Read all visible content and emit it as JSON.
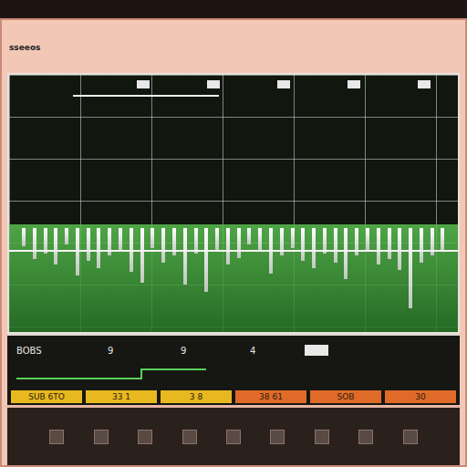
{
  "header": {
    "title": "sseeos"
  },
  "trace": {
    "values": [
      20,
      34,
      28,
      40,
      18,
      52,
      36,
      44,
      30,
      26,
      48,
      60,
      22,
      38,
      30,
      62,
      28,
      70,
      24,
      40,
      33,
      18,
      26,
      50,
      30,
      22,
      36,
      44,
      28,
      38,
      56,
      30,
      24,
      40,
      34,
      46,
      88,
      38,
      30,
      26
    ]
  },
  "readouts": [
    {
      "label": "BOBS"
    },
    {
      "label": "9"
    },
    {
      "label": "9"
    },
    {
      "label": "4"
    }
  ],
  "softkeys": [
    {
      "label": "SUB 6TO",
      "color": "#e8b820"
    },
    {
      "label": "33 1",
      "color": "#e8b820"
    },
    {
      "label": "3 8",
      "color": "#e8b820"
    },
    {
      "label": "38 61",
      "color": "#e06a28"
    },
    {
      "label": "SOB",
      "color": "#e06a28"
    },
    {
      "label": "30",
      "color": "#e06a28"
    }
  ]
}
